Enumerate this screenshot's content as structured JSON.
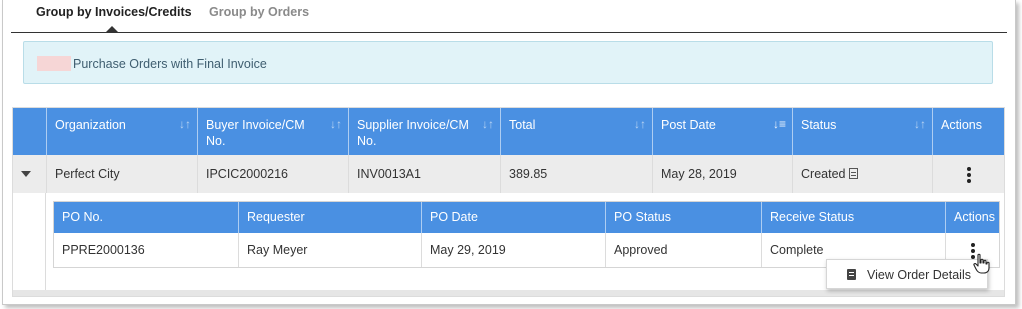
{
  "tabs": [
    {
      "label": "Group by Invoices/Credits",
      "active": true
    },
    {
      "label": "Group by Orders",
      "active": false
    }
  ],
  "legend": {
    "swatch_color": "#f6d6d6",
    "text": "Purchase Orders with Final Invoice"
  },
  "table": {
    "header_color": "#4a90e2",
    "columns": [
      {
        "label": "Organization",
        "sort_icon": "sort-icon"
      },
      {
        "label": "Buyer Invoice/CM No.",
        "sort_icon": "sort-icon"
      },
      {
        "label": "Supplier Invoice/CM No.",
        "sort_icon": "sort-icon"
      },
      {
        "label": "Total",
        "sort_icon": "sort-icon"
      },
      {
        "label": "Post Date",
        "sort_icon": "sort-desc-icon"
      },
      {
        "label": "Status",
        "sort_icon": "sort-icon"
      },
      {
        "label": "Actions"
      }
    ],
    "rows": [
      {
        "organization": "Perfect City",
        "buyer_invoice": "IPCIC2000216",
        "supplier_invoice": "INV0013A1",
        "total": "389.85",
        "post_date": "May 28, 2019",
        "status": "Created",
        "status_icon": "document-icon",
        "expanded": true
      }
    ]
  },
  "subtable": {
    "columns": [
      "PO No.",
      "Requester",
      "PO Date",
      "PO Status",
      "Receive Status",
      "Actions"
    ],
    "rows": [
      {
        "po_no": "PPRE2000136",
        "requester": "Ray Meyer",
        "po_date": "May 29, 2019",
        "po_status": "Approved",
        "receive_status": "Complete"
      }
    ]
  },
  "menu": {
    "items": [
      {
        "label": "View Order Details",
        "icon": "document-icon"
      }
    ]
  }
}
